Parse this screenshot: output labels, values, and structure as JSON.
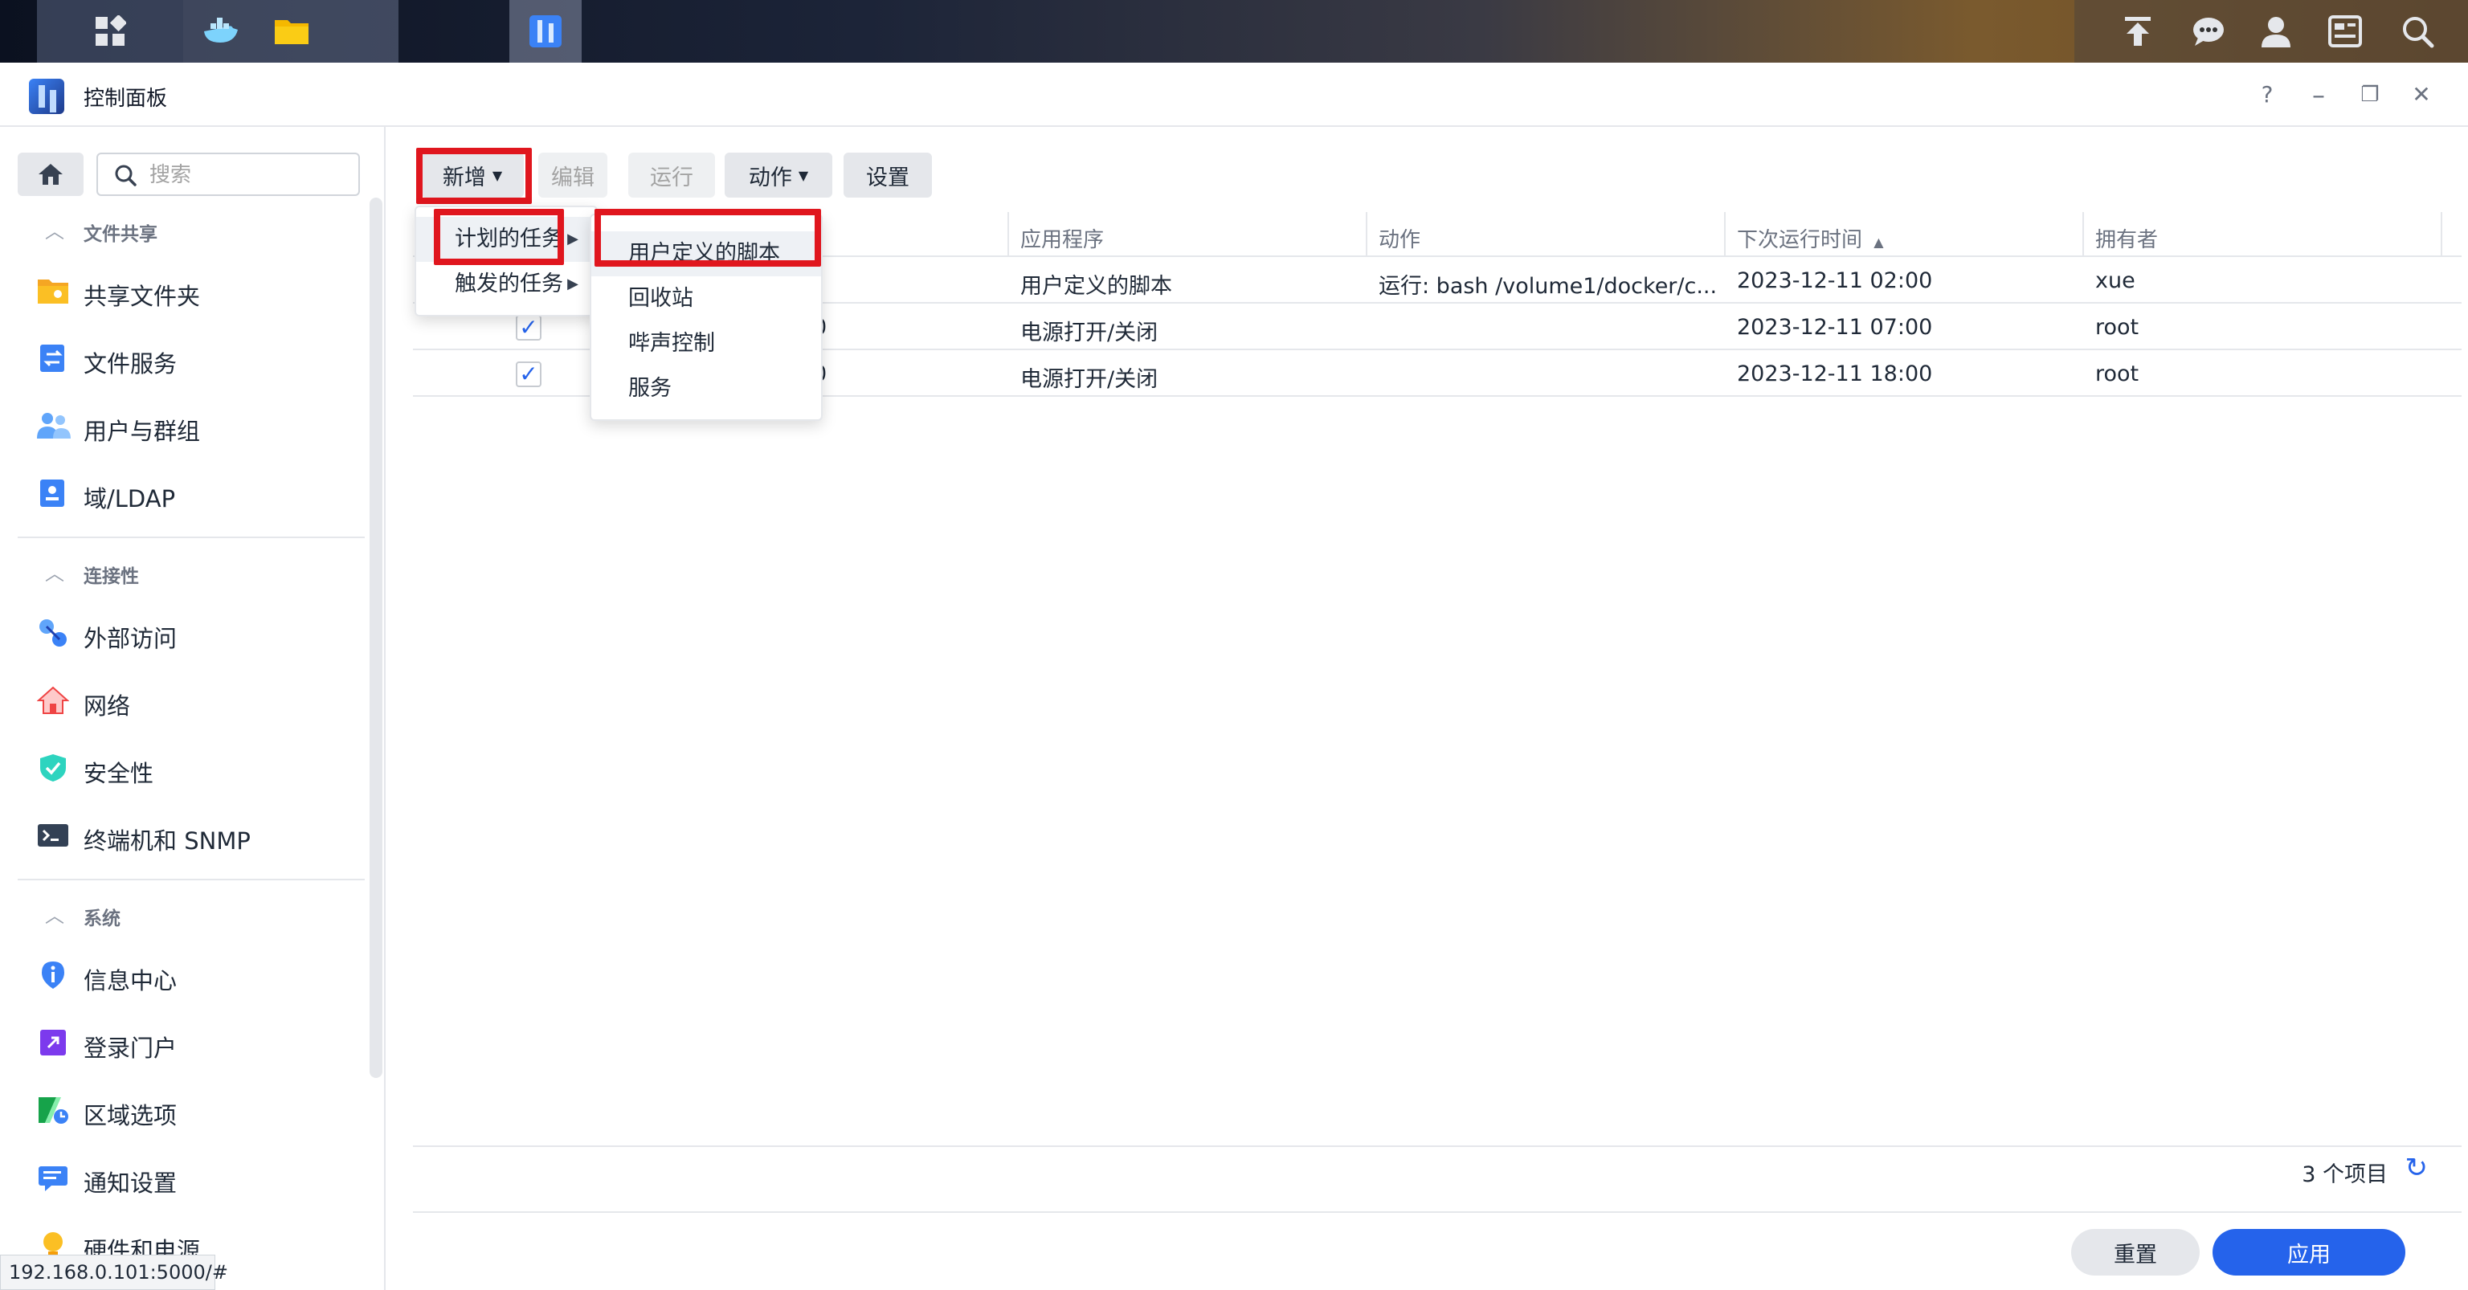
{
  "window": {
    "title": "控制面板",
    "controls": {
      "help": "?",
      "minimize": "–",
      "restore": "❐",
      "close": "✕"
    }
  },
  "sidebar": {
    "search_placeholder": "搜索",
    "sections": [
      {
        "title": "文件共享",
        "items": [
          {
            "label": "共享文件夹",
            "icon": "shared-folder-icon",
            "color": "#f5a623"
          },
          {
            "label": "文件服务",
            "icon": "file-services-icon",
            "color": "#3b82f6"
          },
          {
            "label": "用户与群组",
            "icon": "users-groups-icon",
            "color": "#60a5fa"
          },
          {
            "label": "域/LDAP",
            "icon": "ldap-icon",
            "color": "#3b82f6"
          }
        ]
      },
      {
        "title": "连接性",
        "items": [
          {
            "label": "外部访问",
            "icon": "external-access-icon",
            "color": "#3b82f6"
          },
          {
            "label": "网络",
            "icon": "network-icon",
            "color": "#ef4444"
          },
          {
            "label": "安全性",
            "icon": "security-icon",
            "color": "#14b8a6"
          },
          {
            "label": "终端机和 SNMP",
            "icon": "terminal-icon",
            "color": "#374151"
          }
        ]
      },
      {
        "title": "系统",
        "items": [
          {
            "label": "信息中心",
            "icon": "info-center-icon",
            "color": "#3b82f6"
          },
          {
            "label": "登录门户",
            "icon": "login-portal-icon",
            "color": "#7c3aed"
          },
          {
            "label": "区域选项",
            "icon": "regional-options-icon",
            "color": "#16a34a"
          },
          {
            "label": "通知设置",
            "icon": "notification-icon",
            "color": "#3b82f6"
          },
          {
            "label": "硬件和电源",
            "icon": "hardware-power-icon",
            "color": "#f59e0b"
          }
        ]
      }
    ]
  },
  "toolbar": {
    "add": "新增",
    "edit": "编辑",
    "run": "运行",
    "action": "动作",
    "settings": "设置"
  },
  "add_menu": {
    "items": [
      "计划的任务",
      "触发的任务"
    ]
  },
  "scheduled_submenu": {
    "items": [
      "用户定义的脚本",
      "回收站",
      "哔声控制",
      "服务"
    ]
  },
  "table": {
    "columns": [
      "应用程序",
      "动作",
      "下次运行时间",
      "拥有者"
    ],
    "rows": [
      {
        "enabled": false,
        "name_suffix": "",
        "app": "用户定义的脚本",
        "action": "运行: bash /volume1/docker/c...",
        "next_run": "2023-12-11 02:00",
        "owner": "xue"
      },
      {
        "enabled": true,
        "name_suffix": "0",
        "app": "电源打开/关闭",
        "action": "",
        "next_run": "2023-12-11 07:00",
        "owner": "root"
      },
      {
        "enabled": true,
        "name_suffix": "0",
        "app": "电源打开/关闭",
        "action": "",
        "next_run": "2023-12-11 18:00",
        "owner": "root"
      }
    ]
  },
  "footer": {
    "count": "3 个项目",
    "reset": "重置",
    "apply": "应用"
  },
  "status_url": "192.168.0.101:5000/#"
}
